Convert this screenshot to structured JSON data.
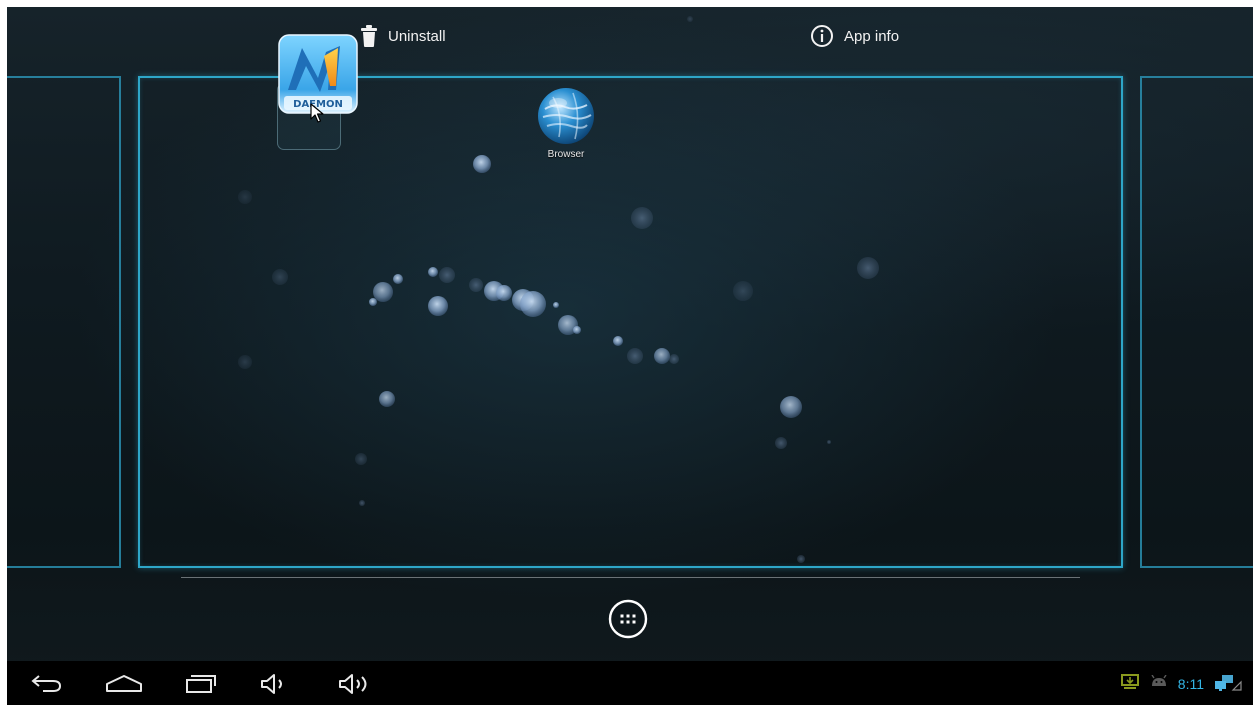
{
  "drop_bar": {
    "uninstall_label": "Uninstall",
    "app_info_label": "App info",
    "uninstall_icon": "trash-icon",
    "app_info_icon": "info-circle-icon"
  },
  "home": {
    "apps": [
      {
        "label": "Browser",
        "icon": "globe-icon"
      }
    ],
    "dragged_app": {
      "logo_text": "DAEMON",
      "icon": "daemon-tools-icon"
    },
    "all_apps_icon": "grid-dots-icon"
  },
  "navigation": {
    "buttons": [
      "back-icon",
      "home-icon",
      "recents-icon",
      "volume-down-icon",
      "volume-up-icon"
    ]
  },
  "status_bar": {
    "time": "8:11",
    "icons": [
      "usb-debug-icon",
      "android-icon",
      "network-icon"
    ]
  },
  "colors": {
    "accent": "#33b5e5",
    "workspace_border": "#2ea6c8",
    "nav_background": "#000000"
  }
}
